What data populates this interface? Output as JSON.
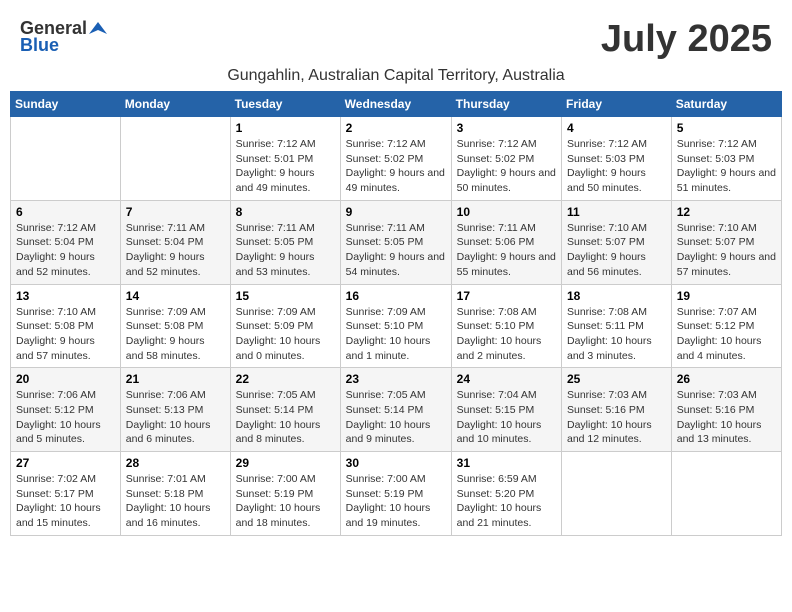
{
  "header": {
    "logo_general": "General",
    "logo_blue": "Blue",
    "title": "July 2025",
    "subtitle": "Gungahlin, Australian Capital Territory, Australia"
  },
  "weekdays": [
    "Sunday",
    "Monday",
    "Tuesday",
    "Wednesday",
    "Thursday",
    "Friday",
    "Saturday"
  ],
  "weeks": [
    [
      {
        "day": "",
        "info": ""
      },
      {
        "day": "",
        "info": ""
      },
      {
        "day": "1",
        "info": "Sunrise: 7:12 AM\nSunset: 5:01 PM\nDaylight: 9 hours and 49 minutes."
      },
      {
        "day": "2",
        "info": "Sunrise: 7:12 AM\nSunset: 5:02 PM\nDaylight: 9 hours and 49 minutes."
      },
      {
        "day": "3",
        "info": "Sunrise: 7:12 AM\nSunset: 5:02 PM\nDaylight: 9 hours and 50 minutes."
      },
      {
        "day": "4",
        "info": "Sunrise: 7:12 AM\nSunset: 5:03 PM\nDaylight: 9 hours and 50 minutes."
      },
      {
        "day": "5",
        "info": "Sunrise: 7:12 AM\nSunset: 5:03 PM\nDaylight: 9 hours and 51 minutes."
      }
    ],
    [
      {
        "day": "6",
        "info": "Sunrise: 7:12 AM\nSunset: 5:04 PM\nDaylight: 9 hours and 52 minutes."
      },
      {
        "day": "7",
        "info": "Sunrise: 7:11 AM\nSunset: 5:04 PM\nDaylight: 9 hours and 52 minutes."
      },
      {
        "day": "8",
        "info": "Sunrise: 7:11 AM\nSunset: 5:05 PM\nDaylight: 9 hours and 53 minutes."
      },
      {
        "day": "9",
        "info": "Sunrise: 7:11 AM\nSunset: 5:05 PM\nDaylight: 9 hours and 54 minutes."
      },
      {
        "day": "10",
        "info": "Sunrise: 7:11 AM\nSunset: 5:06 PM\nDaylight: 9 hours and 55 minutes."
      },
      {
        "day": "11",
        "info": "Sunrise: 7:10 AM\nSunset: 5:07 PM\nDaylight: 9 hours and 56 minutes."
      },
      {
        "day": "12",
        "info": "Sunrise: 7:10 AM\nSunset: 5:07 PM\nDaylight: 9 hours and 57 minutes."
      }
    ],
    [
      {
        "day": "13",
        "info": "Sunrise: 7:10 AM\nSunset: 5:08 PM\nDaylight: 9 hours and 57 minutes."
      },
      {
        "day": "14",
        "info": "Sunrise: 7:09 AM\nSunset: 5:08 PM\nDaylight: 9 hours and 58 minutes."
      },
      {
        "day": "15",
        "info": "Sunrise: 7:09 AM\nSunset: 5:09 PM\nDaylight: 10 hours and 0 minutes."
      },
      {
        "day": "16",
        "info": "Sunrise: 7:09 AM\nSunset: 5:10 PM\nDaylight: 10 hours and 1 minute."
      },
      {
        "day": "17",
        "info": "Sunrise: 7:08 AM\nSunset: 5:10 PM\nDaylight: 10 hours and 2 minutes."
      },
      {
        "day": "18",
        "info": "Sunrise: 7:08 AM\nSunset: 5:11 PM\nDaylight: 10 hours and 3 minutes."
      },
      {
        "day": "19",
        "info": "Sunrise: 7:07 AM\nSunset: 5:12 PM\nDaylight: 10 hours and 4 minutes."
      }
    ],
    [
      {
        "day": "20",
        "info": "Sunrise: 7:06 AM\nSunset: 5:12 PM\nDaylight: 10 hours and 5 minutes."
      },
      {
        "day": "21",
        "info": "Sunrise: 7:06 AM\nSunset: 5:13 PM\nDaylight: 10 hours and 6 minutes."
      },
      {
        "day": "22",
        "info": "Sunrise: 7:05 AM\nSunset: 5:14 PM\nDaylight: 10 hours and 8 minutes."
      },
      {
        "day": "23",
        "info": "Sunrise: 7:05 AM\nSunset: 5:14 PM\nDaylight: 10 hours and 9 minutes."
      },
      {
        "day": "24",
        "info": "Sunrise: 7:04 AM\nSunset: 5:15 PM\nDaylight: 10 hours and 10 minutes."
      },
      {
        "day": "25",
        "info": "Sunrise: 7:03 AM\nSunset: 5:16 PM\nDaylight: 10 hours and 12 minutes."
      },
      {
        "day": "26",
        "info": "Sunrise: 7:03 AM\nSunset: 5:16 PM\nDaylight: 10 hours and 13 minutes."
      }
    ],
    [
      {
        "day": "27",
        "info": "Sunrise: 7:02 AM\nSunset: 5:17 PM\nDaylight: 10 hours and 15 minutes."
      },
      {
        "day": "28",
        "info": "Sunrise: 7:01 AM\nSunset: 5:18 PM\nDaylight: 10 hours and 16 minutes."
      },
      {
        "day": "29",
        "info": "Sunrise: 7:00 AM\nSunset: 5:19 PM\nDaylight: 10 hours and 18 minutes."
      },
      {
        "day": "30",
        "info": "Sunrise: 7:00 AM\nSunset: 5:19 PM\nDaylight: 10 hours and 19 minutes."
      },
      {
        "day": "31",
        "info": "Sunrise: 6:59 AM\nSunset: 5:20 PM\nDaylight: 10 hours and 21 minutes."
      },
      {
        "day": "",
        "info": ""
      },
      {
        "day": "",
        "info": ""
      }
    ]
  ]
}
